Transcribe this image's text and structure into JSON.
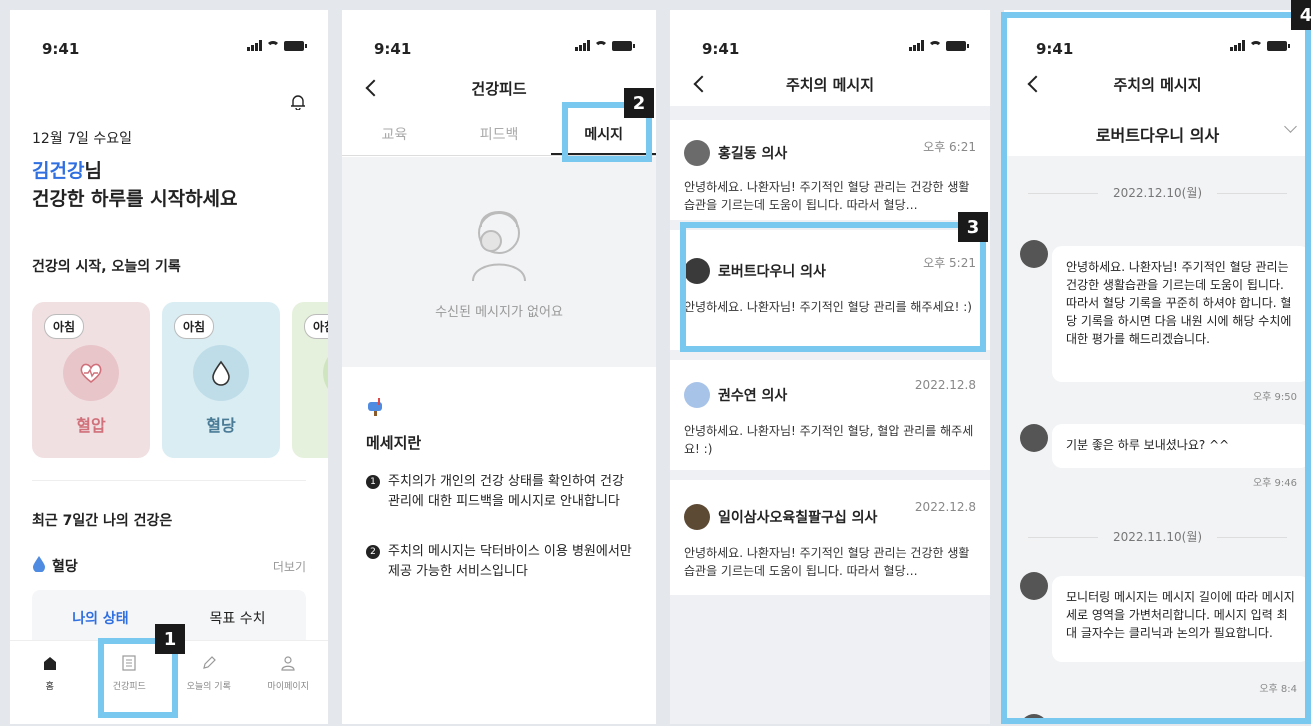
{
  "status_time": "9:41",
  "screen1": {
    "date": "12월 7일 수요일",
    "user_name": "김건강",
    "user_suffix": "님",
    "greeting": "건강한 하루를 시작하세요",
    "section_title": "건강의 시작, 오늘의 기록",
    "cards": [
      {
        "tag": "아침",
        "label": "혈압",
        "color": "#f1e0e2",
        "accent": "#d0707a"
      },
      {
        "tag": "아침",
        "label": "혈당",
        "color": "#d9edf3",
        "accent": "#4a7b96"
      },
      {
        "tag": "아침",
        "label": "",
        "color": "#e5f1dc",
        "accent": "#7aa063"
      }
    ],
    "recent_title": "최근 7일간 나의 건강은",
    "glucose_label": "혈당",
    "more": "더보기",
    "toggle_mine": "나의 상태",
    "toggle_goal": "목표 수치",
    "tabbar": [
      {
        "icon": "home-icon",
        "label": "홈"
      },
      {
        "icon": "document-icon",
        "label": "건강피드"
      },
      {
        "icon": "pencil-icon",
        "label": "오늘의 기록"
      },
      {
        "icon": "person-icon",
        "label": "마이페이지"
      }
    ]
  },
  "screen2": {
    "title": "건강피드",
    "tabs": [
      "교육",
      "피드백",
      "메시지"
    ],
    "empty_text": "수신된 메시지가 없어요",
    "info_title": "메세지란",
    "info_items": [
      "주치의가 개인의 건강 상태를 확인하여 건강 관리에 대한 피드백을 메시지로 안내합니다",
      "주치의 메시지는 닥터바이스 이용 병원에서만 제공 가능한 서비스입니다"
    ]
  },
  "screen3": {
    "title": "주치의 메시지",
    "messages": [
      {
        "name": "홍길동 의사",
        "time": "오후 6:21",
        "body": "안녕하세요. 나환자님! 주기적인 혈당 관리는 건강한 생활습관을 기르는데 도움이 됩니다. 따라서 혈당…"
      },
      {
        "name": "로버트다우니 의사",
        "time": "오후 5:21",
        "body": "안녕하세요. 나환자님! 주기적인 혈당 관리를 해주세요! :)"
      },
      {
        "name": "권수연 의사",
        "time": "2022.12.8",
        "body": "안녕하세요. 나환자님! 주기적인 혈당, 혈압 관리를 해주세요! :)"
      },
      {
        "name": "일이삼사오육칠팔구십 의사",
        "time": "2022.12.8",
        "body": "안녕하세요. 나환자님! 주기적인 혈당 관리는 건강한 생활습관을 기르는데 도움이 됩니다. 따라서 혈당…"
      }
    ]
  },
  "screen4": {
    "title": "주치의 메시지",
    "doctor": "로버트다우니 의사",
    "date1": "2022.12.10(월)",
    "msg1": "안녕하세요. 나환자님! 주기적인 혈당 관리는 건강한 생활습관을 기르는데 도움이 됩니다. 따라서 혈당 기록을 꾸준히 하셔야 합니다. 혈당 기록을 하시면 다음 내원 시에 해당 수치에 대한 평가를 해드리겠습니다.",
    "time1": "오후 9:50",
    "msg2": "기분 좋은 하루 보내셨나요? ^^",
    "time2": "오후 9:46",
    "date2": "2022.11.10(월)",
    "msg3": "모니터링 메시지는 메시지 길이에 따라 메시지 세로 영역을 가변처리합니다. 메시지 입력 최대 글자수는 클리닉과 논의가 필요합니다.",
    "time3": "오후 8:4"
  },
  "badges": [
    "1",
    "2",
    "3",
    "4"
  ],
  "colors": {
    "highlight": "#79c8ef",
    "primary": "#2f6fe0"
  }
}
